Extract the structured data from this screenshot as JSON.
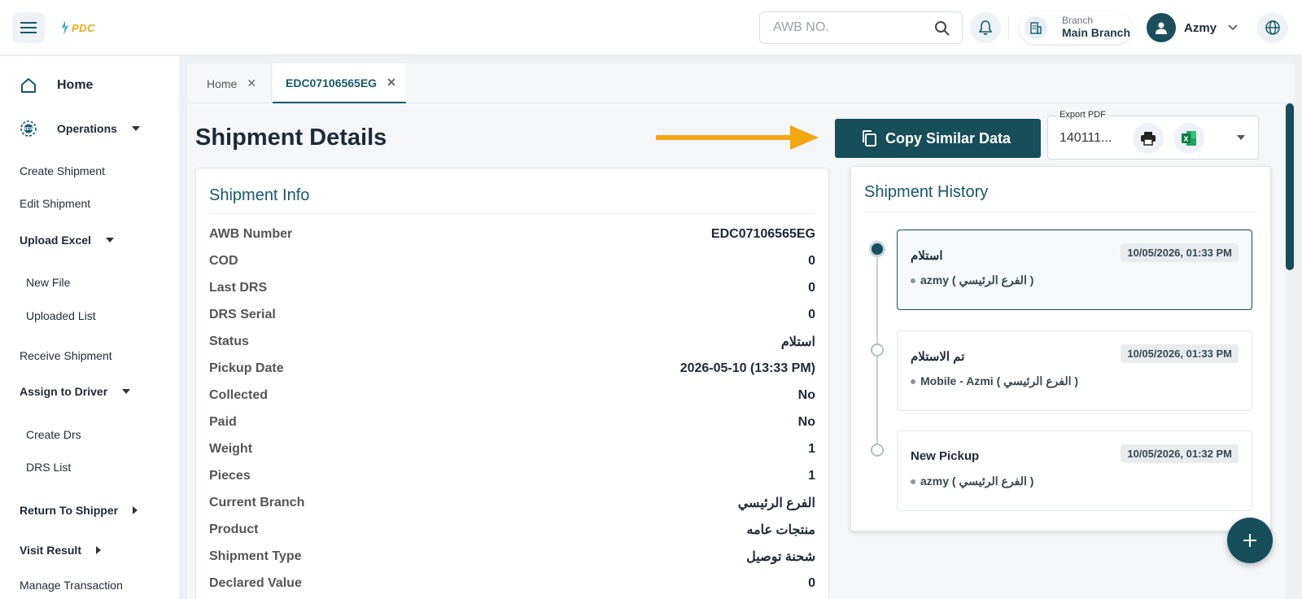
{
  "header": {
    "logo_text": "PDC",
    "search_placeholder": "AWB NO.",
    "branch_label": "Branch",
    "branch_name": "Main Branch",
    "user_name": "Azmy"
  },
  "sidebar": {
    "home": "Home",
    "operations": "Operations",
    "create_shipment": "Create Shipment",
    "edit_shipment": "Edit Shipment",
    "upload_excel": "Upload Excel",
    "new_file": "New File",
    "uploaded_list": "Uploaded List",
    "receive_shipment": "Receive Shipment",
    "assign_to_driver": "Assign to Driver",
    "create_drs": "Create Drs",
    "drs_list": "DRS List",
    "return_to_shipper": "Return To Shipper",
    "visit_result": "Visit Result",
    "manage_transaction": "Manage Transaction"
  },
  "tabs": [
    {
      "label": "Home"
    },
    {
      "label": "EDC07106565EG"
    }
  ],
  "page": {
    "title": "Shipment Details",
    "copy_button": "Copy Similar Data",
    "export_legend": "Export PDF",
    "export_value": "140111..."
  },
  "info": {
    "title": "Shipment Info",
    "rows": [
      {
        "k": "AWB Number",
        "v": "EDC07106565EG"
      },
      {
        "k": "COD",
        "v": "0"
      },
      {
        "k": "Last DRS",
        "v": "0"
      },
      {
        "k": "DRS Serial",
        "v": "0"
      },
      {
        "k": "Status",
        "v": "استلام"
      },
      {
        "k": "Pickup Date",
        "v": "2026-05-10 (13:33 PM)"
      },
      {
        "k": "Collected",
        "v": "No"
      },
      {
        "k": "Paid",
        "v": "No"
      },
      {
        "k": "Weight",
        "v": "1"
      },
      {
        "k": "Pieces",
        "v": "1"
      },
      {
        "k": "Current Branch",
        "v": "الفرع الرئيسي"
      },
      {
        "k": "Product",
        "v": "منتجات عامه"
      },
      {
        "k": "Shipment Type",
        "v": "شحنة توصيل"
      },
      {
        "k": "Declared Value",
        "v": "0"
      }
    ]
  },
  "history": {
    "title": "Shipment History",
    "events": [
      {
        "title": "استلام",
        "date": "10/05/2026, 01:33 PM",
        "by": "azmy ( الفرع الرئيسي )"
      },
      {
        "title": "تم الاستلام",
        "date": "10/05/2026, 01:33 PM",
        "by": "Mobile - Azmi ( الفرع الرئيسي )"
      },
      {
        "title": "New Pickup",
        "date": "10/05/2026, 01:32 PM",
        "by": "azmy ( الفرع الرئيسي )"
      }
    ]
  },
  "colors": {
    "primary": "#164e5a",
    "accent": "#f3a712"
  }
}
